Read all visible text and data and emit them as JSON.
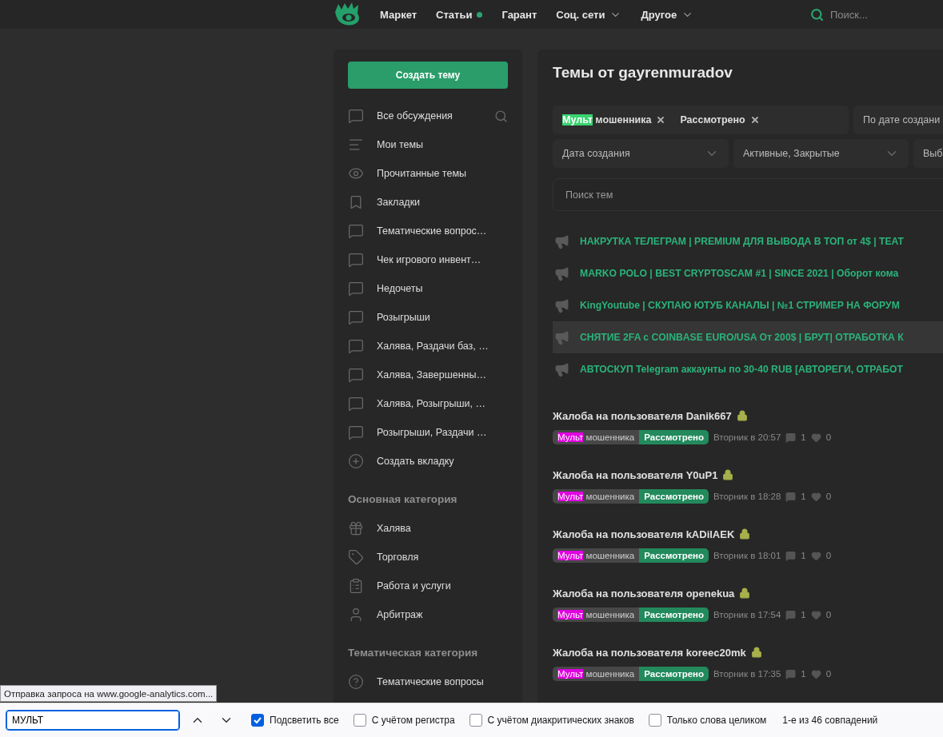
{
  "header": {
    "nav": [
      {
        "label": "Маркет",
        "dot": false,
        "dropdown": false
      },
      {
        "label": "Статьи",
        "dot": true,
        "dropdown": false
      },
      {
        "label": "Гарант",
        "dot": false,
        "dropdown": false
      },
      {
        "label": "Соц. сети",
        "dot": false,
        "dropdown": true
      },
      {
        "label": "Другое",
        "dot": false,
        "dropdown": true
      }
    ],
    "search": {
      "placeholder": "Поиск..."
    }
  },
  "sidebar": {
    "create_button": "Создать тему",
    "items": [
      {
        "label": "Все обсуждения",
        "search": true
      },
      {
        "label": "Мои темы",
        "search": false
      },
      {
        "label": "Прочитанные темы",
        "search": false
      },
      {
        "label": "Закладки",
        "search": false
      },
      {
        "label": "Тематические вопрос…",
        "search": false
      },
      {
        "label": "Чек игрового инвент…",
        "search": false
      },
      {
        "label": "Недочеты",
        "search": false
      },
      {
        "label": "Розыгрыши",
        "search": false
      },
      {
        "label": "Халява, Раздачи баз, …",
        "search": false
      },
      {
        "label": "Халява, Завершенны…",
        "search": false
      },
      {
        "label": "Халява, Розыгрыши, …",
        "search": false
      },
      {
        "label": "Розыгрыши, Раздачи …",
        "search": false
      },
      {
        "label": "Создать вкладку",
        "search": false
      }
    ],
    "sections": [
      {
        "title": "Основная категория",
        "items": [
          "Халява",
          "Торговля",
          "Работа и услуги",
          "Арбитраж"
        ]
      },
      {
        "title": "Тематическая категория",
        "items": [
          "Тематические вопросы"
        ]
      }
    ]
  },
  "main": {
    "title": "Темы от gayrenmuradov",
    "filter_tags": [
      {
        "parts": [
          {
            "text": "Мульт",
            "match": true,
            "current_match": true
          },
          {
            "text": " мошенника",
            "match": false,
            "current_match": false
          }
        ]
      },
      {
        "parts": [
          {
            "text": "Рассмотрено",
            "match": false,
            "current_match": false
          }
        ]
      }
    ],
    "sort": "По дате создани",
    "selects": [
      "Дата создания",
      "Активные, Закрытые",
      "Выб"
    ],
    "search": {
      "placeholder": "Поиск тем"
    },
    "sticky_threads": [
      {
        "title": "НАКРУТКА ТЕЛЕГРАМ | PREMIUM ДЛЯ ВЫВОДА В ТОП от 4$ | TEAT",
        "hovered": false
      },
      {
        "title": "MARKO POLO | BEST CRYPTOSCAM #1 | SINCE 2021 | Оборот кома",
        "hovered": false
      },
      {
        "title": "KingYoutube | СКУПАЮ ЮТУБ КАНАЛЫ | №1 СТРИМЕР НА ФОРУМ",
        "hovered": false
      },
      {
        "title": "СНЯТИЕ 2FA с COINBASE EURO/USA От 200$ | БРУТ| ОТРАБОТКА К",
        "hovered": true
      },
      {
        "title": "АВТОСКУП Telegram аккаунты по 30-40 RUB [АВТОРЕГИ, ОТРАБОТ",
        "hovered": false
      }
    ],
    "threads": [
      {
        "title": "Жалоба на пользователя Danik667",
        "locked": true,
        "prefix": [
          {
            "text": "Мульт",
            "match": true,
            "current_match": false
          },
          {
            "text": " мошенника",
            "match": false,
            "current_match": false
          }
        ],
        "status": "Рассмотрено",
        "date": "Вторник в 20:57",
        "replies": "1",
        "likes": "0"
      },
      {
        "title": "Жалоба на пользователя Y0uP1",
        "locked": true,
        "prefix": [
          {
            "text": "Мульт",
            "match": true,
            "current_match": false
          },
          {
            "text": " мошенника",
            "match": false,
            "current_match": false
          }
        ],
        "status": "Рассмотрено",
        "date": "Вторник в 18:28",
        "replies": "1",
        "likes": "0"
      },
      {
        "title": "Жалоба на пользователя kADilAEK",
        "locked": true,
        "prefix": [
          {
            "text": "Мульт",
            "match": true,
            "current_match": false
          },
          {
            "text": " мошенника",
            "match": false,
            "current_match": false
          }
        ],
        "status": "Рассмотрено",
        "date": "Вторник в 18:01",
        "replies": "1",
        "likes": "0"
      },
      {
        "title": "Жалоба на пользователя openekua",
        "locked": true,
        "prefix": [
          {
            "text": "Мульт",
            "match": true,
            "current_match": false
          },
          {
            "text": " мошенника",
            "match": false,
            "current_match": false
          }
        ],
        "status": "Рассмотрено",
        "date": "Вторник в 17:54",
        "replies": "1",
        "likes": "0"
      },
      {
        "title": "Жалоба на пользователя koreec20mk",
        "locked": true,
        "prefix": [
          {
            "text": "Мульт",
            "match": true,
            "current_match": false
          },
          {
            "text": " мошенника",
            "match": false,
            "current_match": false
          }
        ],
        "status": "Рассмотрено",
        "date": "Вторник в 17:35",
        "replies": "1",
        "likes": "0"
      }
    ]
  },
  "status_tooltip": "Отправка запроса на www.google-analytics.com...",
  "find_bar": {
    "value": "МУЛЬТ",
    "options": [
      {
        "label": "Подсветить все",
        "checked": true
      },
      {
        "label": "С учётом регистра",
        "checked": false
      },
      {
        "label": "С учётом диакритических знаков",
        "checked": false
      },
      {
        "label": "Только слова целиком",
        "checked": false
      }
    ],
    "result": "1-е из 46 совпадений"
  }
}
